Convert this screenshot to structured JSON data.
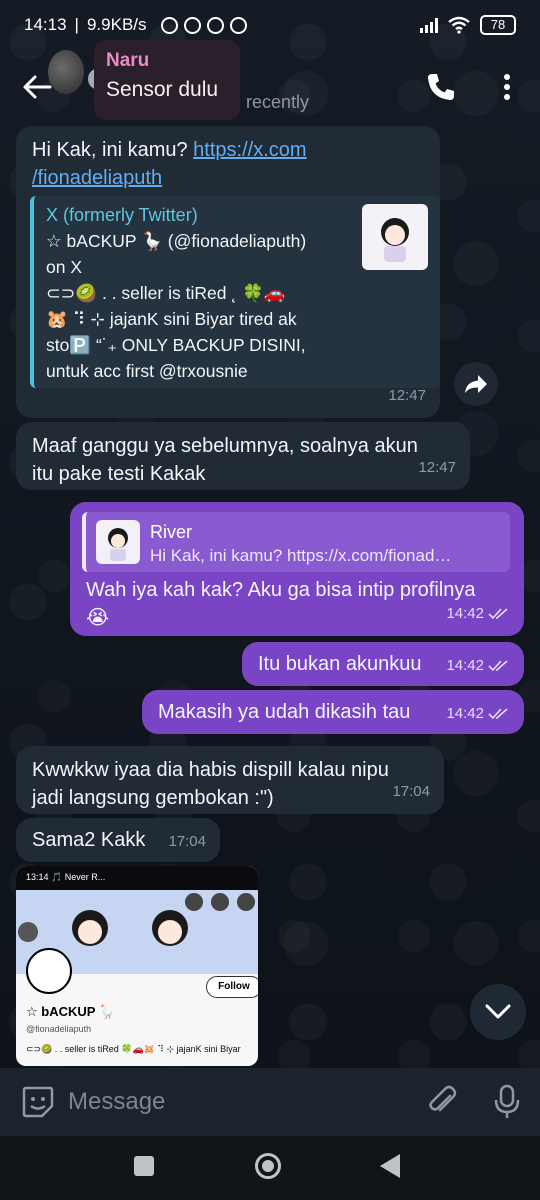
{
  "status_bar": {
    "time": "14:13",
    "speed": "9.9KB/s",
    "battery": "78"
  },
  "header": {
    "contact_name": "Naru",
    "contact_note": "Sensor dulu",
    "last_seen": "recently"
  },
  "messages": [
    {
      "direction": "in",
      "text_prefix": "Hi Kak, ini kamu? ",
      "link": "https://x.com/fionadeliaputh",
      "link_line1": "https://x.com",
      "link_line2": "/fionadeliaputh",
      "preview": {
        "site": "X (formerly Twitter)",
        "title": "☆ bACKUP 🪿 (@fionadeliaputh) on X",
        "title_line1": "☆ bACKUP 🪿 (@fionadeliaputh)",
        "title_line2": "on X",
        "desc_line1": "⊂⊃🥝 . . seller is tiRed ˛ 🍀🚗",
        "desc_line2": "🐹 ⠹ ⊹ jajanK sini Biyar tired ak",
        "desc_line3": "sto🅿️ “˙₊ ONLY BACKUP DISINI,",
        "desc_line4": "untuk acc first @trxousnie"
      },
      "time": "12:47"
    },
    {
      "direction": "in",
      "line1": "Maaf ganggu ya sebelumnya, soalnya akun",
      "line2": "itu pake testi Kakak",
      "time": "12:47"
    },
    {
      "direction": "out",
      "reply_name": "River",
      "reply_text": "Hi Kak, ini kamu? https://x.com/fionad…",
      "line1": "Wah iya kah kak? Aku ga bisa intip profilnya",
      "line2": "😭",
      "time": "14:42"
    },
    {
      "direction": "out",
      "text": "Itu bukan akunkuu",
      "time": "14:42"
    },
    {
      "direction": "out",
      "text": "Makasih ya udah dikasih tau",
      "time": "14:42"
    },
    {
      "direction": "in",
      "line1": "Kwwkkw iyaa dia habis dispill kalau nipu",
      "line2": "jadi langsung gembokan :\")",
      "time": "17:04"
    },
    {
      "direction": "in",
      "text": "Sama2 Kakk",
      "time": "17:04"
    }
  ],
  "screenshot": {
    "time": "13:14",
    "music": "🎵 Never R...",
    "name": "☆ bACKUP 🪿",
    "handle": "@fionadeliaputh",
    "bio": "⊂⊃🥝 . . seller is tiRed 🍀🚗🐹 ⠹ ⊹ jajanK sini Biyar",
    "follow": "Follow"
  },
  "input": {
    "placeholder": "Message"
  },
  "colors": {
    "outgoing_bubble": "#7a45c4",
    "incoming_bubble": "#212b36",
    "link": "#61aef2",
    "name_accent": "#e98ac8"
  }
}
